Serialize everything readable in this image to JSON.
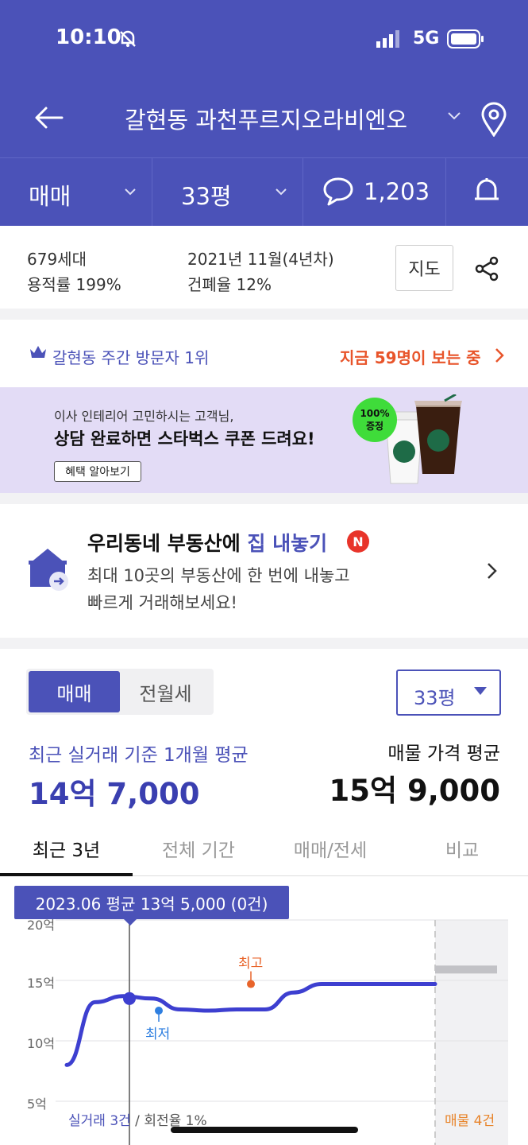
{
  "status_bar": {
    "time": "10:10",
    "network": "5G"
  },
  "header": {
    "title": "갈현동 과천푸르지오라비엔오"
  },
  "subbar": {
    "deal_type": "매매",
    "size": "33평",
    "comments": "1,203"
  },
  "complex_info": {
    "households": "679세대",
    "floor_area_ratio": "용적률 199%",
    "completion": "2021년 11월(4년차)",
    "building_coverage": "건폐율 12%",
    "map_button": "지도"
  },
  "visitor": {
    "rank": "갈현동 주간 방문자 1위",
    "watching": "지금 59명이 보는 중"
  },
  "banner": {
    "line1": "이사 인테리어 고민하시는 고객님,",
    "line2": "상담 완료하면 스타벅스 쿠폰 드려요!",
    "button": "혜택 알아보기",
    "badge_line1": "100%",
    "badge_line2": "증정"
  },
  "sell_listing": {
    "title_prefix": "우리동네 부동산에 ",
    "title_accent": "집 내놓기",
    "new_badge": "N",
    "desc1": "최대 10곳의 부동산에 한 번에 내놓고",
    "desc2": "빠르게 거래해보세요!"
  },
  "price": {
    "seg_on": "매매",
    "seg_off": "전월세",
    "size_select": "33평",
    "avg_label": "최근 실거래 기준 1개월 평균",
    "avg_value": "14억 7,000",
    "listing_label": "매물 가격 평균",
    "listing_value": "15억 9,000"
  },
  "tabs": [
    "최근 3년",
    "전체 기간",
    "매매/전세",
    "비교"
  ],
  "chart": {
    "tooltip": "2023.06 평균 13억 5,000 (0건)",
    "y_labels": [
      "20억",
      "15억",
      "10억",
      "5억"
    ],
    "high_label": "최고",
    "low_label": "최저",
    "footer_deals": "실거래 3건",
    "footer_turnover": " / 회전율 1%",
    "footer_listings": "매물 4건"
  },
  "chart_data": {
    "type": "line",
    "ylim": [
      5,
      20
    ],
    "y_ticks": [
      "20억",
      "15억",
      "10억",
      "5억"
    ],
    "series": [
      {
        "values": [
          8.0,
          13.2,
          13.7,
          13.5,
          12.6,
          12.5,
          12.6,
          12.6,
          14.0,
          14.7,
          14.7,
          14.7,
          14.7,
          14.7
        ]
      }
    ],
    "listing_price": 15.9,
    "colors": {
      "line": "#3d3fd0",
      "high": "#e8642a",
      "low": "#2f7fe0"
    }
  },
  "colors": {
    "brand": "#4b52b8",
    "accent_orange": "#e8542a",
    "banner_bg": "#e3dcf6"
  }
}
